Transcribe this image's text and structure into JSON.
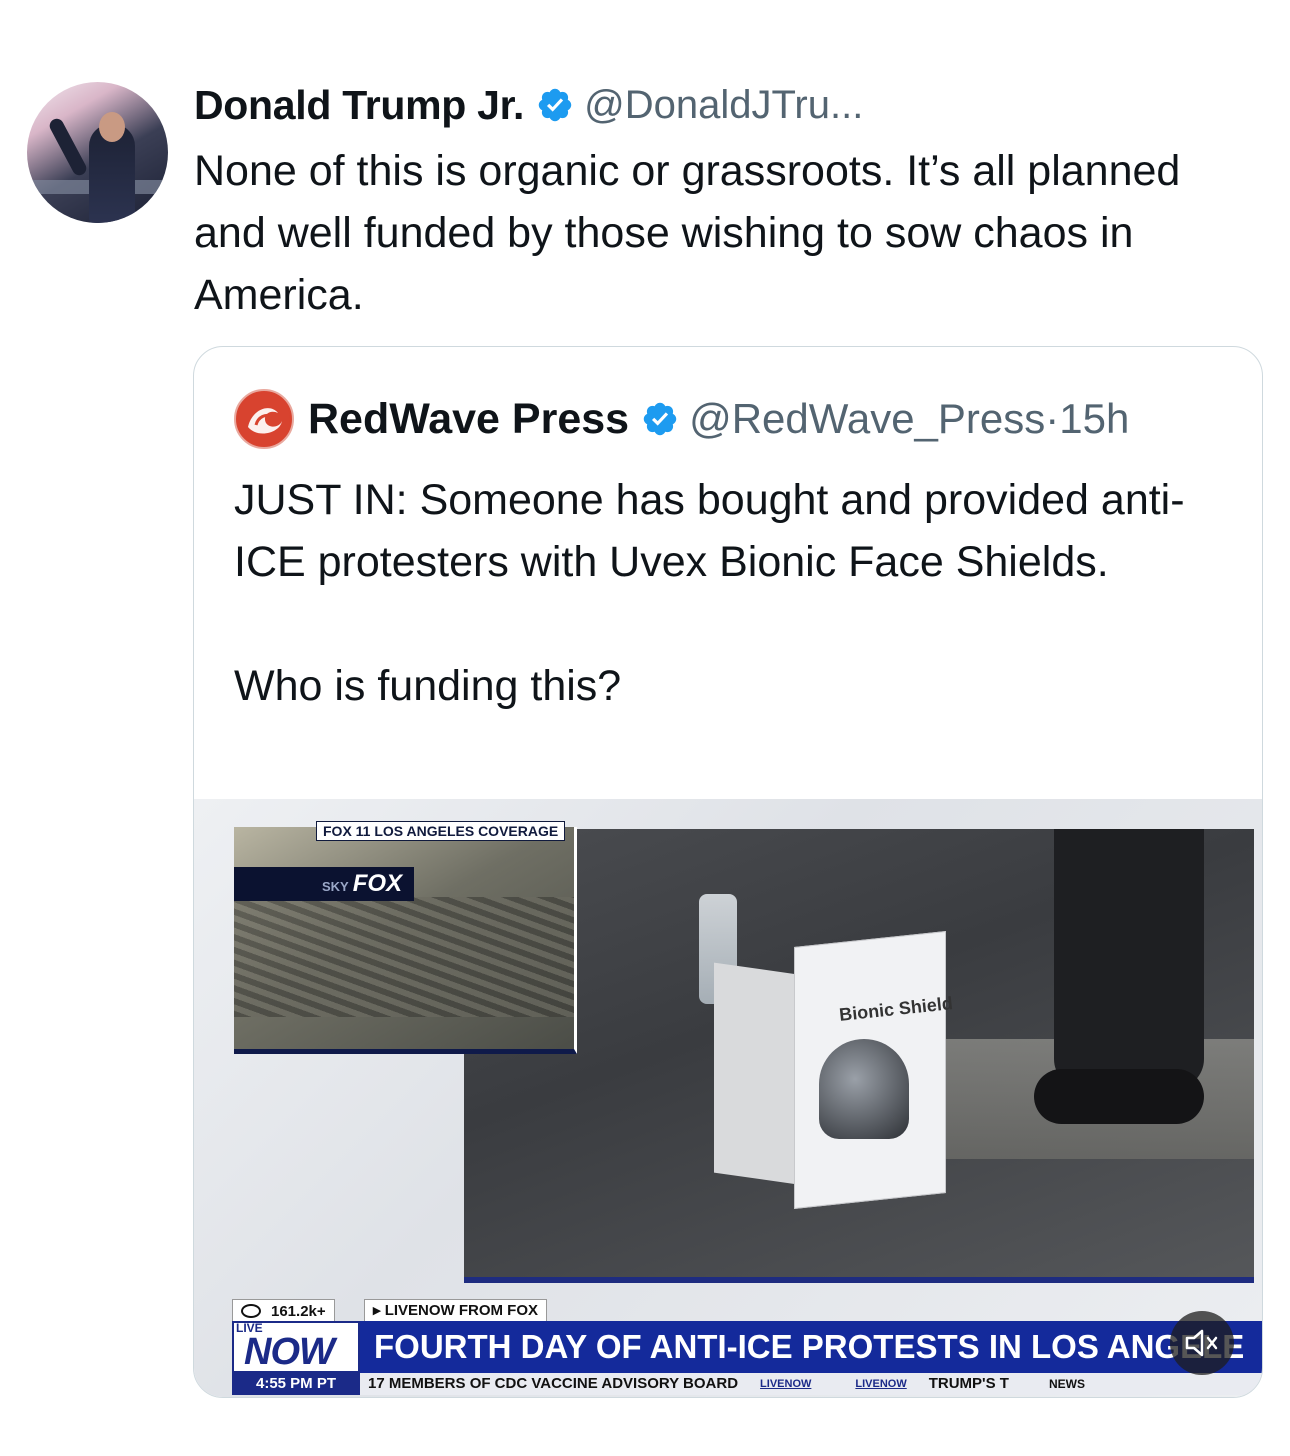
{
  "tweet": {
    "author_name": "Donald Trump Jr.",
    "author_handle": "@DonaldJTru...",
    "text": "None of this is organic or grassroots. It’s all planned and well funded by those wishing to sow chaos in America.",
    "verified_icon": "verified-badge-icon",
    "avatar_icon": "avatar"
  },
  "quoted_tweet": {
    "author_name": "RedWave Press",
    "author_handle": "@RedWave_Press",
    "separator": " · ",
    "time": "15h",
    "text_paragraphs": [
      "JUST IN: Someone has bought and provided anti-ICE protesters with Uvex Bionic Face Shields.",
      "Who is funding this?"
    ]
  },
  "video": {
    "inset_label": "FOX 11 LOS ANGELES COVERAGE",
    "inset_brand_small": "SKY",
    "inset_brand": "FOX",
    "views": "161.2k+",
    "livenow_label": "▸ LIVENOW FROM FOX",
    "live_label": "LIVE",
    "now_label": "NOW",
    "headline": "FOURTH DAY OF ANTI-ICE PROTESTS IN LOS ANGELE",
    "clock": "4:55 PM PT",
    "ticker_text": "17 MEMBERS OF CDC VACCINE ADVISORY BOARD",
    "ticker_sep": "LIVENOW",
    "ticker_more": "TRUMP'S T",
    "ticker_news": "NEWS",
    "box_label": "Bionic Shield",
    "mute_icon": "muted-speaker-icon"
  },
  "colors": {
    "verified": "#1d9bf0",
    "secondary_text": "#536471",
    "fox_blue": "#142a9b",
    "border": "#cfd9de"
  }
}
